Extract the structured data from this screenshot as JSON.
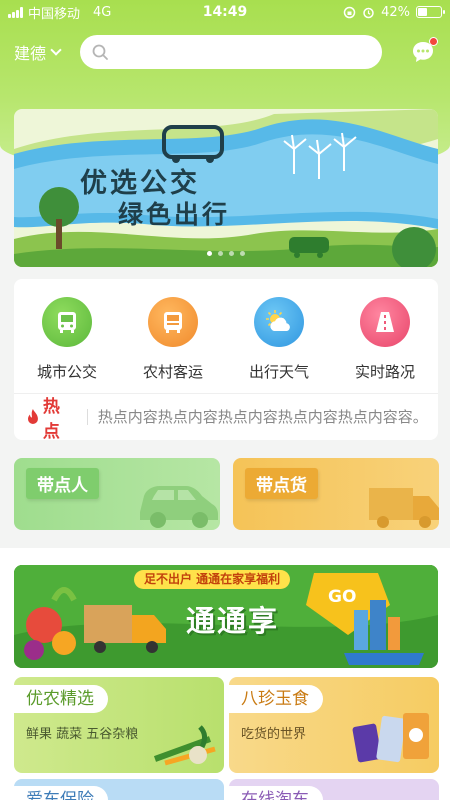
{
  "status_bar": {
    "carrier": "中国移动",
    "network": "4G",
    "time": "14:49",
    "battery": "42%"
  },
  "header": {
    "city": "建德",
    "search_placeholder": ""
  },
  "banner": {
    "line1": "优选公交",
    "line2": "绿色出行",
    "page_count": 4,
    "active_page": 0
  },
  "services": [
    {
      "label": "城市公交",
      "icon": "bus-icon",
      "color": "#6cc24a"
    },
    {
      "label": "农村客运",
      "icon": "coach-icon",
      "color": "#f39a3d"
    },
    {
      "label": "出行天气",
      "icon": "weather-icon",
      "color": "#3aa6ea"
    },
    {
      "label": "实时路况",
      "icon": "road-icon",
      "color": "#ef5a7a"
    }
  ],
  "hot": {
    "tag": "热点",
    "text": "热点内容热点内容热点内容热点内容热点内容容。"
  },
  "cards": {
    "carry_people": "带点人",
    "carry_goods": "带点货"
  },
  "promo": {
    "strip": "足不出户 通通在家享福利",
    "title": "通通享",
    "go": "GO"
  },
  "tiles": [
    {
      "title": "优农精选",
      "subtitle": "鲜果 蔬菜 五谷杂粮"
    },
    {
      "title": "八珍玉食",
      "subtitle": "吃货的世界"
    },
    {
      "title": "爱车保险"
    },
    {
      "title": "在线淘车"
    }
  ],
  "colors": {
    "primary_green": "#a8df4f",
    "hot_red": "#e23a37"
  }
}
